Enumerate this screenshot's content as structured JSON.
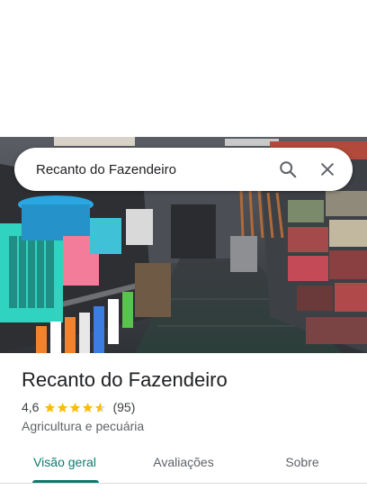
{
  "search": {
    "query": "Recanto do Fazendeiro",
    "search_icon": "search-icon",
    "close_icon": "close-icon"
  },
  "place": {
    "name": "Recanto do Fazendeiro",
    "rating": "4,6",
    "rating_value": 4.6,
    "review_count": "(95)",
    "category": "Agricultura e pecuária"
  },
  "tabs": [
    {
      "label": "Visão geral",
      "active": true
    },
    {
      "label": "Avaliações",
      "active": false
    },
    {
      "label": "Sobre",
      "active": false
    }
  ],
  "colors": {
    "accent": "#0b7b6e",
    "star": "#fbbc04"
  }
}
